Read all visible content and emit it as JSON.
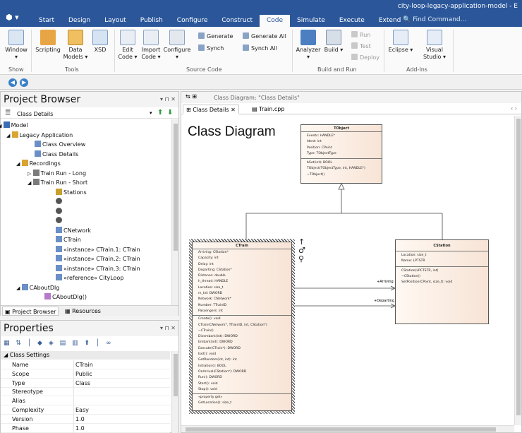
{
  "window": {
    "title": "city-loop-legacy-application-model - E"
  },
  "ribbon_tabs": [
    "Start",
    "Design",
    "Layout",
    "Publish",
    "Configure",
    "Construct",
    "Code",
    "Simulate",
    "Execute",
    "Extend"
  ],
  "active_tab": "Code",
  "search_placeholder": "Find Command...",
  "ribbon": {
    "window_label": "Window",
    "show_group": "Show",
    "scripting": "Scripting",
    "data_models": "Data Models",
    "xsd": "XSD",
    "tools_group": "Tools",
    "edit_code": "Edit Code",
    "import_code": "Import Code",
    "configure": "Configure",
    "generate": "Generate",
    "synch": "Synch",
    "generate_all": "Generate All",
    "synch_all": "Synch All",
    "source_group": "Source Code",
    "analyzer": "Analyzer",
    "build": "Build",
    "run": "Run",
    "test": "Test",
    "deploy": "Deploy",
    "buildrun_group": "Build and Run",
    "eclipse": "Eclipse",
    "visual_studio": "Visual Studio",
    "addins_group": "Add-Ins"
  },
  "project_browser": {
    "title": "Project Browser",
    "current": "Class Details",
    "items": [
      {
        "label": "Model"
      },
      {
        "label": "Legacy Application"
      },
      {
        "label": "Class Overview"
      },
      {
        "label": "Class Details"
      },
      {
        "label": "Recordings"
      },
      {
        "label": "Train Run - Long"
      },
      {
        "label": "Train Run - Short"
      },
      {
        "label": "Stations"
      },
      {
        "label": ""
      },
      {
        "label": ""
      },
      {
        "label": ""
      },
      {
        "label": "CNetwork"
      },
      {
        "label": "CTrain"
      },
      {
        "label": "«instance» CTrain.1: CTrain"
      },
      {
        "label": "«instance» CTrain.2: CTrain"
      },
      {
        "label": "«instance» CTrain.3: CTrain"
      },
      {
        "label": "«reference» CityLoop"
      },
      {
        "label": "CAboutDlg"
      },
      {
        "label": "CAboutDlg()"
      }
    ],
    "tab_browser": "Project Browser",
    "tab_resources": "Resources"
  },
  "properties": {
    "title": "Properties",
    "section": "Class Settings",
    "rows": [
      {
        "key": "Name",
        "value": "CTrain"
      },
      {
        "key": "Scope",
        "value": "Public"
      },
      {
        "key": "Type",
        "value": "Class"
      },
      {
        "key": "Stereotype",
        "value": ""
      },
      {
        "key": "Alias",
        "value": ""
      },
      {
        "key": "Complexity",
        "value": "Easy"
      },
      {
        "key": "Version",
        "value": "1.0"
      },
      {
        "key": "Phase",
        "value": "1.0"
      }
    ]
  },
  "diagram": {
    "header": "Class Diagram: \"Class Details\"",
    "tab1": "Class Details",
    "tab2": "Train.cpp",
    "title": "Class Diagram",
    "tobject": {
      "name": "TObject",
      "attrs": [
        "Events: HANDLE*",
        "Ident: int",
        "Position: CPoint",
        "Type: TObjectType"
      ],
      "ops": [
        "bSet(int): BOOL",
        "TObject(TObjectType, int, HANDLE*)",
        "~TObject()"
      ]
    },
    "ctrain": {
      "name": "CTrain",
      "attrs": [
        "Arriving: CStation*",
        "Capacity: int",
        "Delay: int",
        "Departing: CStation*",
        "Distance: double",
        "h_thread: HANDLE",
        "Location: size_t",
        "m_tid: DWORD",
        "Network: CNetwork*",
        "Number: TTrainID",
        "Passengers: int"
      ],
      "ops": [
        "Create(): void",
        "CTrain(CNetwork*, TTrainID, int, CStation*)",
        "~CTrain()",
        "Disembark(int): DWORD",
        "Embark(int): DWORD",
        "Execute(CTrain*): DWORD",
        "Exit(): void",
        "GetRandom(int, int): int",
        "Initiation(): BOOL",
        "OnArrival(CStation*): DWORD",
        "Run(): DWORD",
        "Start(): void",
        "Stop(): void"
      ],
      "prop_label": "«property get»",
      "prop": [
        "GetLocation(): size_t"
      ]
    },
    "cstation": {
      "name": "CStation",
      "attrs": [
        "Location: size_t",
        "Name: LPTSTR"
      ],
      "ops": [
        "CStation(LPCTSTR, int)",
        "~CStation()",
        "SetPosition(CPoint, size_t): void"
      ]
    },
    "assoc_arriving": "+Arriving",
    "assoc_departing": "+Departing"
  }
}
